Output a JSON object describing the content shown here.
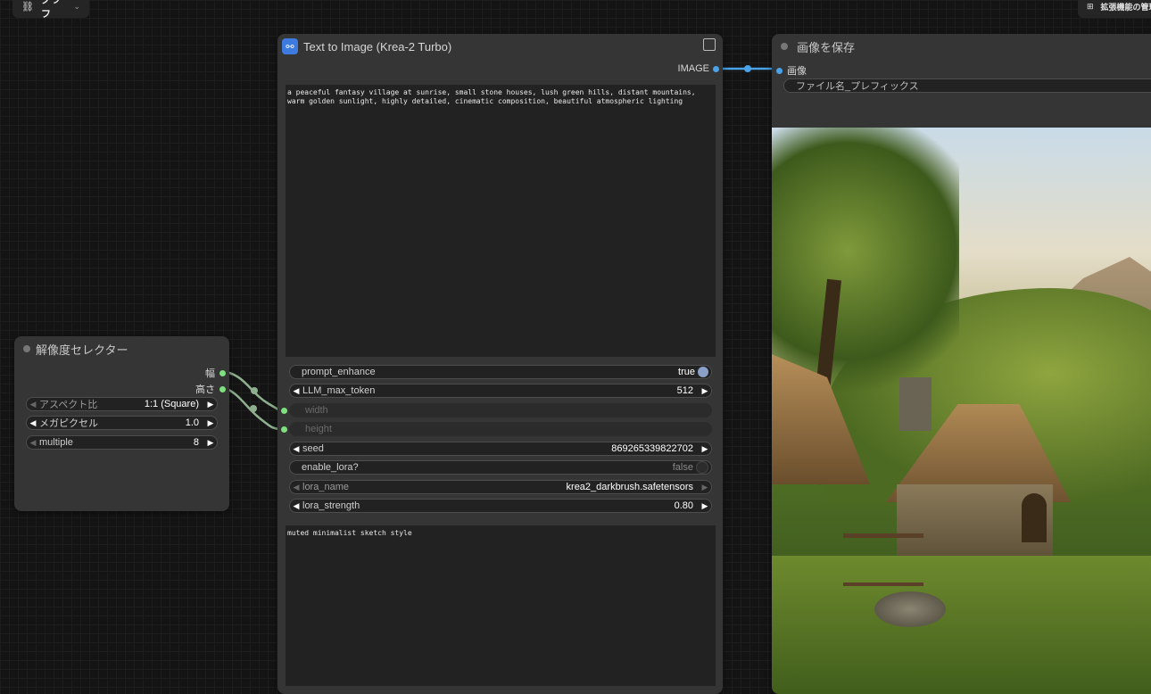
{
  "topbar": {
    "graph_label": "グラフ",
    "extensions_label": "拡張機能の管理"
  },
  "node_t2i": {
    "title": "Text to Image (Krea-2 Turbo)",
    "output_label": "IMAGE",
    "prompt_text": "a peaceful fantasy village at sunrise, small stone houses, lush green hills, distant mountains, warm golden sunlight, highly detailed, cinematic composition, beautiful atmospheric lighting",
    "widgets": {
      "prompt_enhance": {
        "label": "prompt_enhance",
        "value": "true"
      },
      "llm_max_token": {
        "label": "LLM_max_token",
        "value": "512"
      },
      "width": {
        "label": "width"
      },
      "height": {
        "label": "height"
      },
      "seed": {
        "label": "seed",
        "value": "869265339822702"
      },
      "enable_lora": {
        "label": "enable_lora?",
        "value": "false"
      },
      "lora_name": {
        "label": "lora_name",
        "value": "krea2_darkbrush.safetensors"
      },
      "lora_strength": {
        "label": "lora_strength",
        "value": "0.80"
      }
    },
    "lora_prompt_text": "muted minimalist sketch style"
  },
  "node_res": {
    "title": "解像度セレクター",
    "output_width": "幅",
    "output_height": "高さ",
    "widgets": {
      "aspect": {
        "label": "アスペクト比",
        "value": "1:1 (Square)"
      },
      "megapixel": {
        "label": "メガピクセル",
        "value": "1.0"
      },
      "multiple": {
        "label": "multiple",
        "value": "8"
      }
    }
  },
  "node_save": {
    "title": "画像を保存",
    "input_label": "画像",
    "filename_prefix_label": "ファイル名_プレフィックス"
  },
  "colors": {
    "image_link": "#4aa3e8",
    "int_link": "#8fb08f",
    "int_socket": "#7ee07e",
    "accent": "#3d7be0"
  }
}
